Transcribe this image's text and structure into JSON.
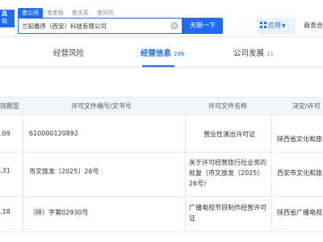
{
  "header": {
    "logo_text": "具\n公",
    "search_tabs": [
      "查公司",
      "查老板",
      "查关系",
      "查风险"
    ],
    "search_value": "兰知春序（西安）科技有限公司",
    "clear_icon": "×",
    "search_button": "天眼一下",
    "app_button": "应用",
    "business_link": "商务合"
  },
  "tabs": [
    {
      "label": "经营风险",
      "count": ""
    },
    {
      "label": "经营信息",
      "count": "296"
    },
    {
      "label": "公司发展",
      "count": "21"
    }
  ],
  "table": {
    "columns": [
      "效期至",
      "许可文件编号/文书号",
      "许可文件名称",
      "决定/许可"
    ],
    "rows": [
      {
        "date": ".09",
        "number": "610000120892",
        "name": "营业性演出许可证",
        "authority": "陕西省文化和旅"
      },
      {
        "date": ".31",
        "number": "市文旅发〔2025〕26号",
        "name": "关于许可经营旅行社业务的批复（市文旅发〔2025〕26号）",
        "authority": "西安市文化和旅"
      },
      {
        "date": ".18",
        "number": "（陕）字第02930号",
        "name": "广播电视节目制作经营许可证",
        "authority": "陕西省广播电视"
      }
    ]
  },
  "colors": {
    "accent": "#1f6cf3",
    "table_header_bg": "#f2f6fc",
    "border": "#e3e7ef"
  }
}
